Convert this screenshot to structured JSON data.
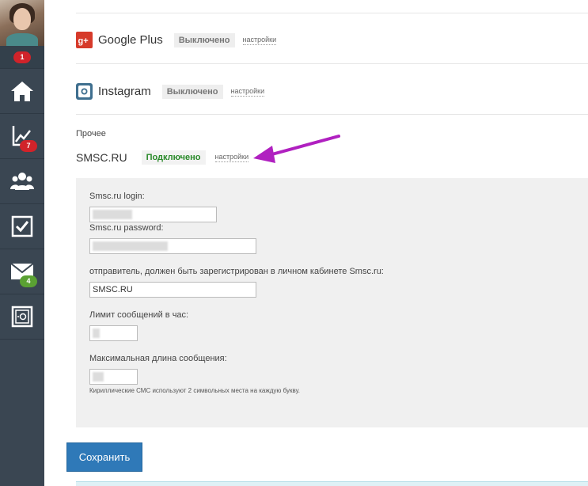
{
  "sidebar": {
    "avatar_badge": "1",
    "nav": [
      {
        "name": "home",
        "badge": null
      },
      {
        "name": "chart",
        "badge": "7"
      },
      {
        "name": "users",
        "badge": null
      },
      {
        "name": "tasks",
        "badge": null
      },
      {
        "name": "mail",
        "badge": "4"
      },
      {
        "name": "settings-box",
        "badge": null
      }
    ],
    "colors": {
      "bg": "#3a4652",
      "badge_red": "#d0232a",
      "badge_green": "#5aa133"
    }
  },
  "services": [
    {
      "name": "Google Plus",
      "status": "Выключено",
      "settings": "настройки",
      "icon": "google-plus-icon"
    },
    {
      "name": "Instagram",
      "status": "Выключено",
      "settings": "настройки",
      "icon": "instagram-icon"
    }
  ],
  "other": {
    "label": "Прочее",
    "service": {
      "name": "SMSC.RU",
      "status": "Подключено",
      "settings": "настройки"
    }
  },
  "form": {
    "login_label": "Smsc.ru login:",
    "login_value": "",
    "password_label": "Smsc.ru password:",
    "password_value": "",
    "sender_label": "отправитель, должен быть зарегистрирован в личном кабинете Smsc.ru:",
    "sender_value": "SMSC.RU",
    "limit_label": "Лимит сообщений в час:",
    "limit_value": "",
    "maxlen_label": "Максимальная длина сообщения:",
    "maxlen_value": "",
    "hint": "Кириллические СМС используют 2 символьных места на каждую букву."
  },
  "actions": {
    "save_label": "Сохранить"
  },
  "accent": {
    "arrow_color": "#b020c0",
    "status_on_color": "#2a8a2a",
    "button_color": "#2f79b8"
  }
}
